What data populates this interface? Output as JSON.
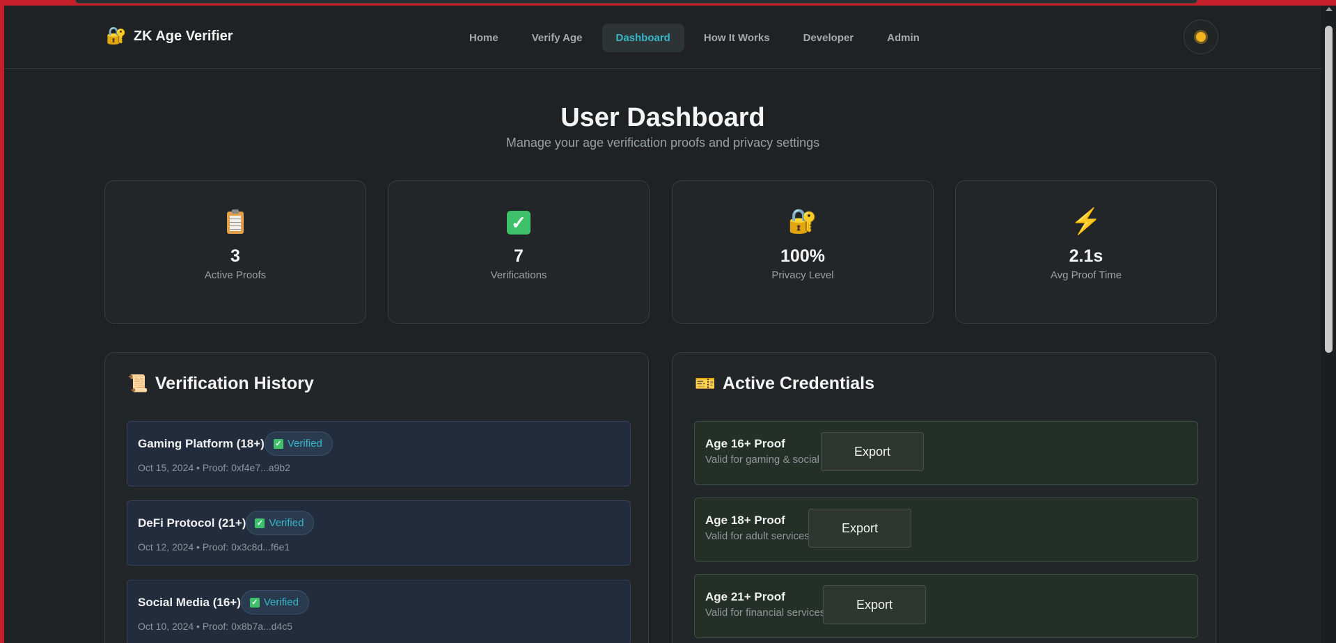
{
  "app": {
    "name": "ZK Age Verifier",
    "brand_icon": "lock-with-key-icon"
  },
  "nav": {
    "links": [
      {
        "label": "Home"
      },
      {
        "label": "Verify Age"
      },
      {
        "label": "Dashboard",
        "active": true
      },
      {
        "label": "How It Works"
      },
      {
        "label": "Developer"
      },
      {
        "label": "Admin"
      }
    ],
    "theme_toggle_icon": "sun-icon"
  },
  "header": {
    "title": "User Dashboard",
    "subtitle": "Manage your age verification proofs and privacy settings"
  },
  "stats": [
    {
      "icon": "clipboard-icon",
      "value": "3",
      "label": "Active Proofs"
    },
    {
      "icon": "check-mark-icon",
      "value": "7",
      "label": "Verifications"
    },
    {
      "icon": "lock-with-key-icon",
      "value": "100%",
      "label": "Privacy Level"
    },
    {
      "icon": "lightning-bolt-icon",
      "value": "2.1s",
      "label": "Avg Proof Time"
    }
  ],
  "history": {
    "title": "Verification History",
    "icon": "scroll-icon",
    "items": [
      {
        "name": "Gaming Platform (18+)",
        "status": "Verified",
        "meta": "Oct 15, 2024 • Proof: 0xf4e7...a9b2"
      },
      {
        "name": "DeFi Protocol (21+)",
        "status": "Verified",
        "meta": "Oct 12, 2024 • Proof: 0x3c8d...f6e1"
      },
      {
        "name": "Social Media (16+)",
        "status": "Verified",
        "meta": "Oct 10, 2024 • Proof: 0x8b7a...d4c5"
      }
    ]
  },
  "credentials": {
    "title": "Active Credentials",
    "icon": "ticket-icon",
    "items": [
      {
        "name": "Age 16+ Proof",
        "desc": "Valid for gaming & social",
        "action": "Export"
      },
      {
        "name": "Age 18+ Proof",
        "desc": "Valid for adult services",
        "action": "Export"
      },
      {
        "name": "Age 21+ Proof",
        "desc": "Valid for financial services",
        "action": "Export"
      }
    ]
  },
  "colors": {
    "accent": "#36b7c9",
    "background": "#1f2122",
    "card": "#232628",
    "verified_green": "#3ec16a",
    "window_frame": "#c8202a"
  }
}
